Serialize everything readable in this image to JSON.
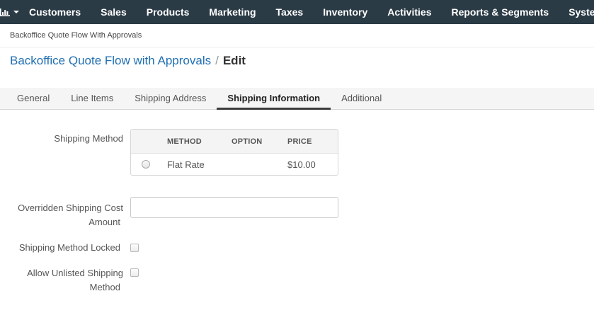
{
  "nav": {
    "dashboard_icon": "bar-chart-icon",
    "items": [
      "Customers",
      "Sales",
      "Products",
      "Marketing",
      "Taxes",
      "Inventory",
      "Activities",
      "Reports & Segments",
      "System"
    ]
  },
  "breadcrumb": "Backoffice Quote Flow With Approvals",
  "title": {
    "link": "Backoffice Quote Flow with Approvals",
    "separator": "/",
    "action": "Edit"
  },
  "tabs": [
    "General",
    "Line Items",
    "Shipping Address",
    "Shipping Information",
    "Additional"
  ],
  "active_tab": "Shipping Information",
  "form": {
    "shipping_method_label": "Shipping Method",
    "table": {
      "headers": [
        "METHOD",
        "OPTION",
        "PRICE"
      ],
      "rows": [
        {
          "method": "Flat Rate",
          "option": "",
          "price": "$10.00",
          "selected": false
        }
      ]
    },
    "overridden_cost_label_line1": "Overridden Shipping Cost",
    "overridden_cost_label_line2": "Amount",
    "overridden_cost_value": "",
    "method_locked_label": "Shipping Method Locked",
    "method_locked_checked": false,
    "allow_unlisted_label_line1": "Allow Unlisted Shipping",
    "allow_unlisted_label_line2": "Method",
    "allow_unlisted_checked": false
  },
  "colors": {
    "nav_bg": "#2b3b46",
    "link": "#1f6fb2",
    "tabs_bg": "#f5f5f5"
  }
}
